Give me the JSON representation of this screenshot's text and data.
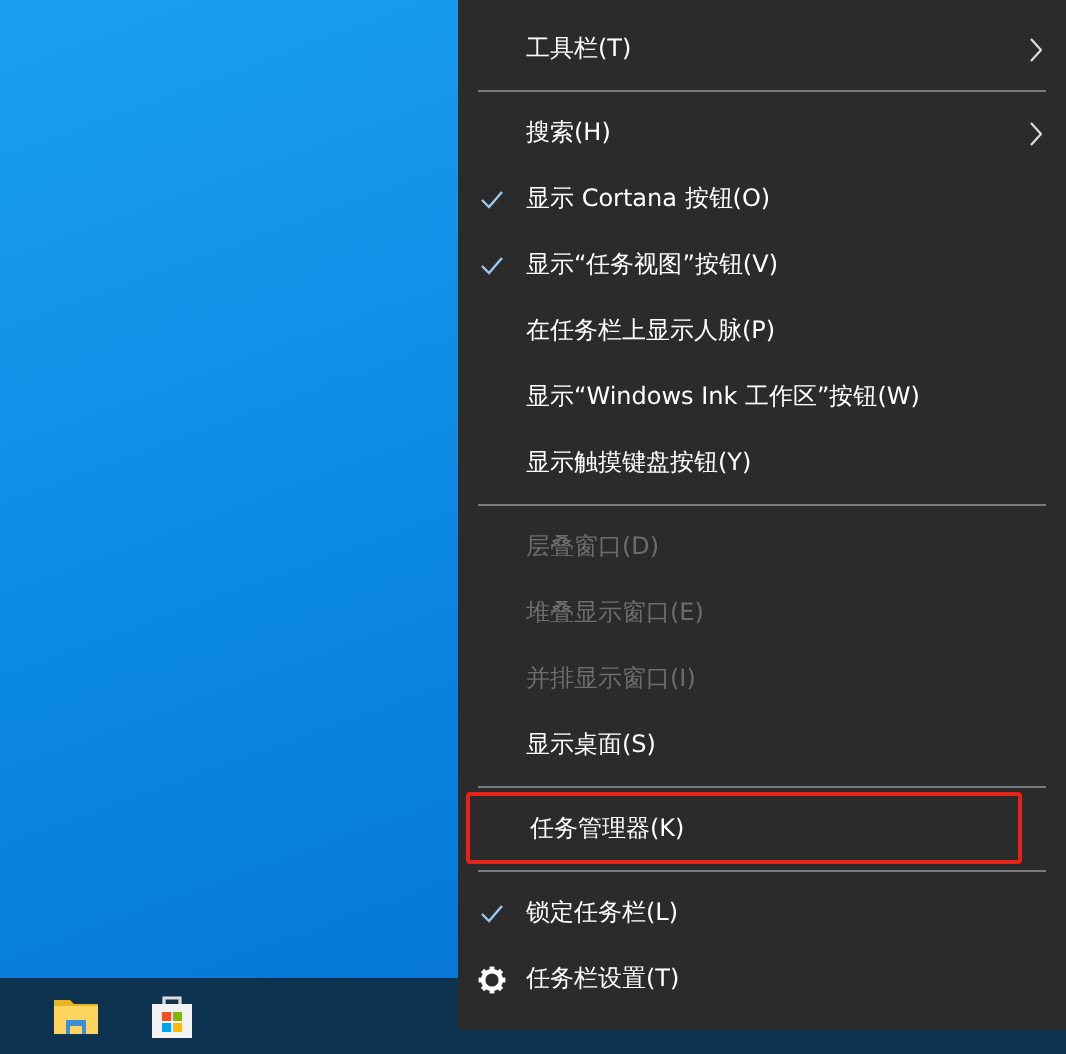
{
  "menu": {
    "items": [
      {
        "kind": "item",
        "label": "工具栏(T)",
        "checked": false,
        "disabled": false,
        "submenu": true,
        "highlighted": false
      },
      {
        "kind": "separator"
      },
      {
        "kind": "item",
        "label": "搜索(H)",
        "checked": false,
        "disabled": false,
        "submenu": true,
        "highlighted": false
      },
      {
        "kind": "item",
        "label": "显示 Cortana 按钮(O)",
        "checked": true,
        "disabled": false,
        "submenu": false,
        "highlighted": false
      },
      {
        "kind": "item",
        "label": "显示“任务视图”按钮(V)",
        "checked": true,
        "disabled": false,
        "submenu": false,
        "highlighted": false
      },
      {
        "kind": "item",
        "label": "在任务栏上显示人脉(P)",
        "checked": false,
        "disabled": false,
        "submenu": false,
        "highlighted": false
      },
      {
        "kind": "item",
        "label": "显示“Windows Ink 工作区”按钮(W)",
        "checked": false,
        "disabled": false,
        "submenu": false,
        "highlighted": false
      },
      {
        "kind": "item",
        "label": "显示触摸键盘按钮(Y)",
        "checked": false,
        "disabled": false,
        "submenu": false,
        "highlighted": false
      },
      {
        "kind": "separator"
      },
      {
        "kind": "item",
        "label": "层叠窗口(D)",
        "checked": false,
        "disabled": true,
        "submenu": false,
        "highlighted": false
      },
      {
        "kind": "item",
        "label": "堆叠显示窗口(E)",
        "checked": false,
        "disabled": true,
        "submenu": false,
        "highlighted": false
      },
      {
        "kind": "item",
        "label": "并排显示窗口(I)",
        "checked": false,
        "disabled": true,
        "submenu": false,
        "highlighted": false
      },
      {
        "kind": "item",
        "label": "显示桌面(S)",
        "checked": false,
        "disabled": false,
        "submenu": false,
        "highlighted": false
      },
      {
        "kind": "separator"
      },
      {
        "kind": "item",
        "label": "任务管理器(K)",
        "checked": false,
        "disabled": false,
        "submenu": false,
        "highlighted": true
      },
      {
        "kind": "separator"
      },
      {
        "kind": "item",
        "label": "锁定任务栏(L)",
        "checked": true,
        "disabled": false,
        "submenu": false,
        "highlighted": false
      },
      {
        "kind": "settings",
        "label": "任务栏设置(T)",
        "checked": false,
        "disabled": false,
        "submenu": false,
        "highlighted": false
      }
    ]
  }
}
